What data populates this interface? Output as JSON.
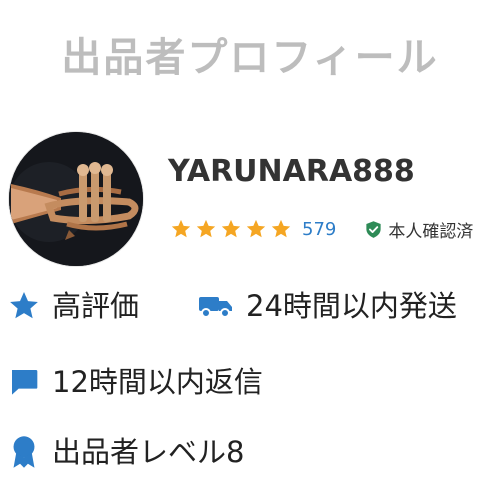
{
  "page": {
    "title": "出品者プロフィール"
  },
  "seller": {
    "username": "YARUNARA888",
    "rating_stars": 5,
    "review_count": "579",
    "verified_label": "本人確認済"
  },
  "badges": [
    {
      "icon": "star-icon",
      "label": "高評価"
    },
    {
      "icon": "delivery-truck-icon",
      "label": "24時間以内発送"
    },
    {
      "icon": "chat-bubble-icon",
      "label": "12時間以内返信"
    },
    {
      "icon": "ribbon-medal-icon",
      "label": "出品者レベル8"
    }
  ],
  "colors": {
    "title": "#bdbdbd",
    "star": "#f5a623",
    "accent_blue": "#2d7dc8",
    "verified_green": "#2e8b57",
    "text": "#222222"
  }
}
